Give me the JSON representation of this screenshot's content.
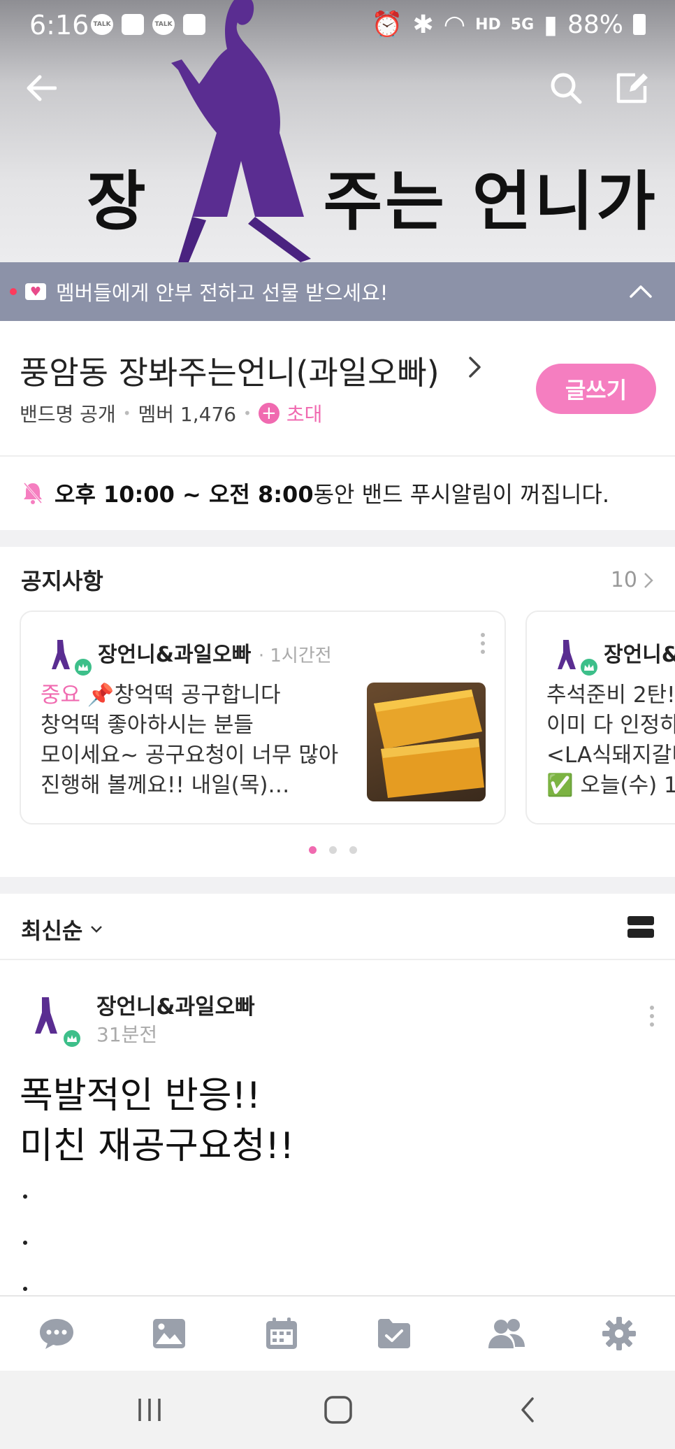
{
  "status_bar": {
    "time": "6:16",
    "notif_icons": [
      "TALK",
      "instagram",
      "TALK",
      "gallery"
    ],
    "hd": "HD",
    "net": "5G",
    "battery": "88%"
  },
  "header": {
    "banner_text_1": "장",
    "banner_text_2": "주는 언니가",
    "icons": [
      "back-arrow-icon",
      "search-icon",
      "write-icon"
    ]
  },
  "promo": {
    "text": "멤버들에게 안부 전하고 선물 받으세요!"
  },
  "band": {
    "name": "풍암동 장봐주는언니(과일오빠)",
    "visibility": "밴드명 공개",
    "members": "멤버 1,476",
    "invite": "초대",
    "write_button": "글쓰기"
  },
  "push_notice": {
    "time_range": "오후 10:00 ~ 오전 8:00",
    "text": " 동안 밴드 푸시알림이 꺼집니다."
  },
  "notices": {
    "title": "공지사항",
    "count": "10",
    "cards": [
      {
        "author": "장언니&과일오빠",
        "time": "1시간전",
        "tag": "중요",
        "lines": [
          "📌창억떡 공구합니다",
          "창억떡 좋아하시는 분들",
          "모이세요~ 공구요청이 너무 많아",
          "진행해 볼께요!! 내일(목)…"
        ]
      },
      {
        "author": "장언니&",
        "lines": [
          "추석준비 2탄!",
          "이미 다 인정하",
          "<LA식돼지갈비",
          "✅ 오늘(수) 1"
        ]
      }
    ]
  },
  "feed": {
    "sort_label": "최신순",
    "post": {
      "author": "장언니&과일오빠",
      "time": "31분전",
      "line1": "폭발적인 반응!!",
      "line2": "미친 재공구요청!!"
    }
  },
  "colors": {
    "accent_pink": "#f57ec0",
    "promo_bg": "#8c92a8",
    "crown_green": "#3dbf8a"
  }
}
